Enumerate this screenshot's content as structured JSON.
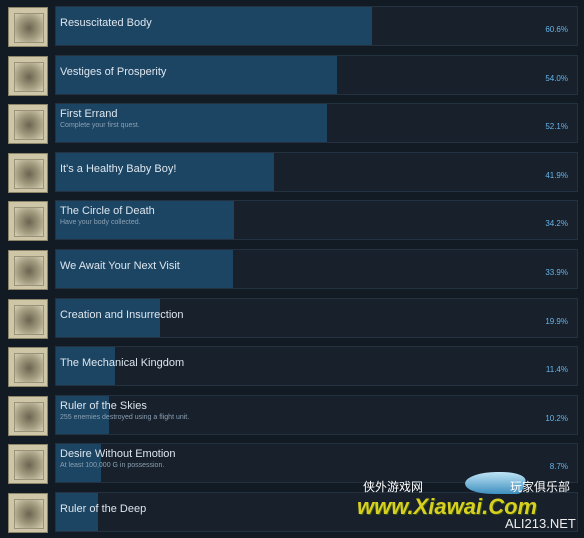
{
  "achievements": [
    {
      "name": "Resuscitated Body",
      "desc": "",
      "percent": "60.6%",
      "value": 60.6
    },
    {
      "name": "Vestiges of Prosperity",
      "desc": "",
      "percent": "54.0%",
      "value": 54.0
    },
    {
      "name": "First Errand",
      "desc": "Complete your first quest.",
      "percent": "52.1%",
      "value": 52.1
    },
    {
      "name": "It's a Healthy Baby Boy!",
      "desc": "",
      "percent": "41.9%",
      "value": 41.9
    },
    {
      "name": "The Circle of Death",
      "desc": "Have your body collected.",
      "percent": "34.2%",
      "value": 34.2
    },
    {
      "name": "We Await Your Next Visit",
      "desc": "",
      "percent": "33.9%",
      "value": 33.9
    },
    {
      "name": "Creation and Insurrection",
      "desc": "",
      "percent": "19.9%",
      "value": 19.9
    },
    {
      "name": "The Mechanical Kingdom",
      "desc": "",
      "percent": "11.4%",
      "value": 11.4
    },
    {
      "name": "Ruler of the Skies",
      "desc": "255 enemies destroyed using a flight unit.",
      "percent": "10.2%",
      "value": 10.2
    },
    {
      "name": "Desire Without Emotion",
      "desc": "At least 100,000 G in possession.",
      "percent": "8.7%",
      "value": 8.7
    },
    {
      "name": "Ruler of the Deep",
      "desc": "",
      "percent": "",
      "value": 8.0
    }
  ],
  "watermark": {
    "left": "侠外游戏网",
    "right": "玩家俱乐部",
    "site": "www.Xiawai.Com",
    "sub": "ALI213.NET"
  },
  "colors": {
    "fill": "#1c4563",
    "percent": "#67b5ea"
  }
}
